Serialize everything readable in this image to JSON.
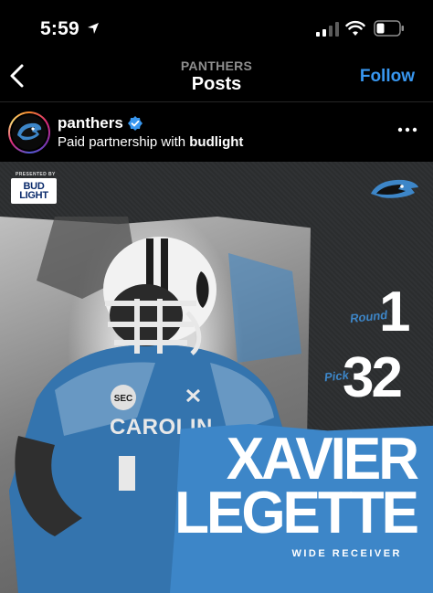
{
  "status_bar": {
    "time": "5:59"
  },
  "header": {
    "account_label": "PANTHERS",
    "title": "Posts",
    "follow_label": "Follow"
  },
  "post": {
    "username": "panthers",
    "partnership_prefix": "Paid partnership with ",
    "partner": "budlight"
  },
  "graphic": {
    "presented_by": "PRESENTED BY",
    "sponsor_line1": "BUD",
    "sponsor_line2": "LIGHT",
    "jersey_text": "CAROLIN",
    "helmet_badge": "SEC",
    "round_label": "Round",
    "round": "1",
    "pick_label": "Pick",
    "pick": "32",
    "first_name": "XAVIER",
    "last_name": "LEGETTE",
    "position": "WIDE RECEIVER"
  },
  "colors": {
    "accent_blue": "#3d86c8",
    "link_blue": "#3897f0",
    "background": "#000000"
  },
  "icons": {
    "location": "location-arrow-icon",
    "signal": "cellular-signal-icon",
    "wifi": "wifi-icon",
    "battery": "battery-icon",
    "back": "chevron-left-icon",
    "verified": "verified-badge-icon",
    "more": "more-options-icon"
  }
}
